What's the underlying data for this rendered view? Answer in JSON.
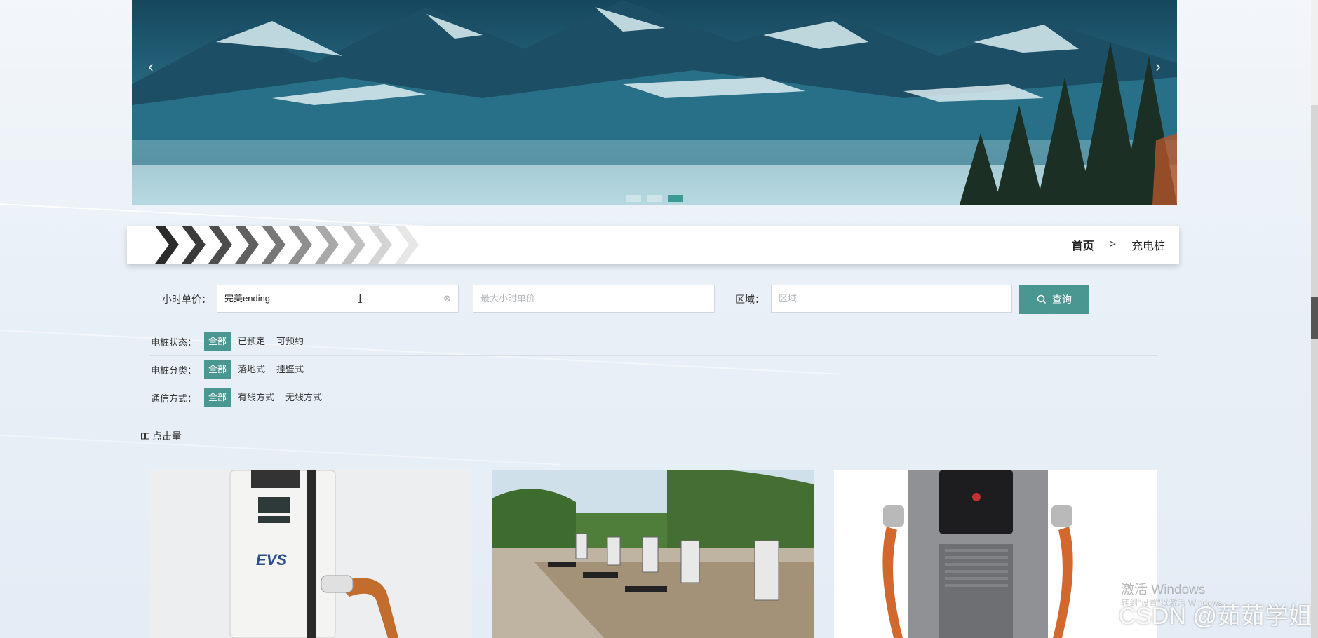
{
  "breadcrumb": {
    "home": "首页",
    "separator": ">",
    "current": "充电桩"
  },
  "banner": {
    "prev_icon": "chevron-left",
    "next_icon": "chevron-right",
    "slides": 3,
    "active_slide": 3
  },
  "search": {
    "price_label": "小时单价：",
    "min_price_value": "完美ending",
    "max_price_placeholder": "最大小时单价",
    "region_label": "区域：",
    "region_placeholder": "区域",
    "button_label": "查询"
  },
  "filters": [
    {
      "label": "电桩状态：",
      "options": [
        "全部",
        "已预定",
        "可预约"
      ],
      "active": 0
    },
    {
      "label": "电桩分类：",
      "options": [
        "全部",
        "落地式",
        "挂壁式"
      ],
      "active": 0
    },
    {
      "label": "通信方式：",
      "options": [
        "全部",
        "有线方式",
        "无线方式"
      ],
      "active": 0
    }
  ],
  "sort": {
    "label": "点击量"
  },
  "overlay": {
    "activate_title": "激活 Windows",
    "activate_sub": "转到\"设置\"以激活 Windows。",
    "watermark": "CSDN @茹茹学姐"
  },
  "colors": {
    "accent": "#4a9690",
    "breadcrumb_bg": "#ffffff"
  }
}
